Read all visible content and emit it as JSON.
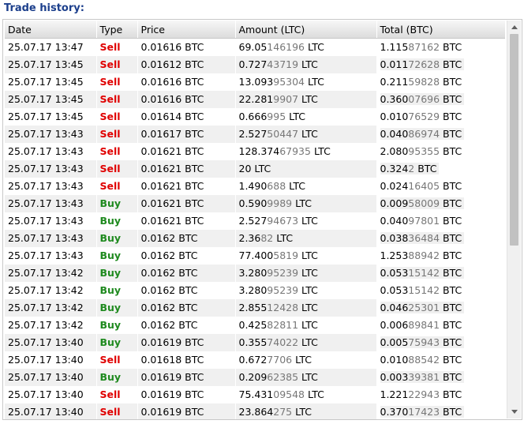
{
  "panel": {
    "title": "Trade history:"
  },
  "table": {
    "headers": [
      "Date",
      "Type",
      "Price",
      "Amount (LTC)",
      "Total (BTC)"
    ],
    "rows": [
      {
        "date": "25.07.17 13:47",
        "type": "Sell",
        "price": "0.01616 BTC",
        "amount": [
          "69.05",
          "146196",
          " LTC"
        ],
        "total": [
          "1.115",
          "87162",
          " BTC"
        ]
      },
      {
        "date": "25.07.17 13:45",
        "type": "Sell",
        "price": "0.01612 BTC",
        "amount": [
          "0.727",
          "43719",
          " LTC"
        ],
        "total": [
          "0.011",
          "72628",
          " BTC"
        ]
      },
      {
        "date": "25.07.17 13:45",
        "type": "Sell",
        "price": "0.01616 BTC",
        "amount": [
          "13.093",
          "95304",
          " LTC"
        ],
        "total": [
          "0.211",
          "59828",
          " BTC"
        ]
      },
      {
        "date": "25.07.17 13:45",
        "type": "Sell",
        "price": "0.01616 BTC",
        "amount": [
          "22.281",
          "9907",
          " LTC"
        ],
        "total": [
          "0.360",
          "07696",
          " BTC"
        ]
      },
      {
        "date": "25.07.17 13:45",
        "type": "Sell",
        "price": "0.01614 BTC",
        "amount": [
          "0.666",
          "995",
          " LTC"
        ],
        "total": [
          "0.010",
          "76529",
          " BTC"
        ]
      },
      {
        "date": "25.07.17 13:43",
        "type": "Sell",
        "price": "0.01617 BTC",
        "amount": [
          "2.527",
          "50447",
          " LTC"
        ],
        "total": [
          "0.040",
          "86974",
          " BTC"
        ]
      },
      {
        "date": "25.07.17 13:43",
        "type": "Sell",
        "price": "0.01621 BTC",
        "amount": [
          "128.374",
          "67935",
          " LTC"
        ],
        "total": [
          "2.080",
          "95355",
          " BTC"
        ]
      },
      {
        "date": "25.07.17 13:43",
        "type": "Sell",
        "price": "0.01621 BTC",
        "amount": [
          "20",
          "",
          "",
          " LTC"
        ],
        "total": [
          "0.324",
          "2",
          " BTC"
        ]
      },
      {
        "date": "25.07.17 13:43",
        "type": "Sell",
        "price": "0.01621 BTC",
        "amount": [
          "1.490",
          "688",
          " LTC"
        ],
        "total": [
          "0.024",
          "16405",
          " BTC"
        ]
      },
      {
        "date": "25.07.17 13:43",
        "type": "Buy",
        "price": "0.01621 BTC",
        "amount": [
          "0.590",
          "9989",
          " LTC"
        ],
        "total": [
          "0.009",
          "58009",
          " BTC"
        ]
      },
      {
        "date": "25.07.17 13:43",
        "type": "Buy",
        "price": "0.01621 BTC",
        "amount": [
          "2.527",
          "94673",
          " LTC"
        ],
        "total": [
          "0.040",
          "97801",
          " BTC"
        ]
      },
      {
        "date": "25.07.17 13:43",
        "type": "Buy",
        "price": "0.0162 BTC",
        "amount": [
          "2.36",
          "82",
          " LTC"
        ],
        "total": [
          "0.038",
          "36484",
          " BTC"
        ]
      },
      {
        "date": "25.07.17 13:43",
        "type": "Buy",
        "price": "0.0162 BTC",
        "amount": [
          "77.400",
          "5819",
          " LTC"
        ],
        "total": [
          "1.253",
          "88942",
          " BTC"
        ]
      },
      {
        "date": "25.07.17 13:42",
        "type": "Buy",
        "price": "0.0162 BTC",
        "amount": [
          "3.280",
          "95239",
          " LTC"
        ],
        "total": [
          "0.053",
          "15142",
          " BTC"
        ]
      },
      {
        "date": "25.07.17 13:42",
        "type": "Buy",
        "price": "0.0162 BTC",
        "amount": [
          "3.280",
          "95239",
          " LTC"
        ],
        "total": [
          "0.053",
          "15142",
          " BTC"
        ]
      },
      {
        "date": "25.07.17 13:42",
        "type": "Buy",
        "price": "0.0162 BTC",
        "amount": [
          "2.855",
          "12428",
          " LTC"
        ],
        "total": [
          "0.046",
          "25301",
          " BTC"
        ]
      },
      {
        "date": "25.07.17 13:42",
        "type": "Buy",
        "price": "0.0162 BTC",
        "amount": [
          "0.425",
          "82811",
          " LTC"
        ],
        "total": [
          "0.006",
          "89841",
          " BTC"
        ]
      },
      {
        "date": "25.07.17 13:40",
        "type": "Buy",
        "price": "0.01619 BTC",
        "amount": [
          "0.355",
          "74022",
          " LTC"
        ],
        "total": [
          "0.005",
          "75943",
          " BTC"
        ]
      },
      {
        "date": "25.07.17 13:40",
        "type": "Sell",
        "price": "0.01618 BTC",
        "amount": [
          "0.672",
          "7706",
          " LTC"
        ],
        "total": [
          "0.010",
          "88542",
          " BTC"
        ]
      },
      {
        "date": "25.07.17 13:40",
        "type": "Buy",
        "price": "0.01619 BTC",
        "amount": [
          "0.209",
          "62385",
          " LTC"
        ],
        "total": [
          "0.003",
          "39381",
          " BTC"
        ]
      },
      {
        "date": "25.07.17 13:40",
        "type": "Sell",
        "price": "0.01619 BTC",
        "amount": [
          "75.431",
          "09548",
          " LTC"
        ],
        "total": [
          "1.221",
          "22943",
          " BTC"
        ]
      },
      {
        "date": "25.07.17 13:40",
        "type": "Sell",
        "price": "0.01619 BTC",
        "amount": [
          "23.864",
          "275",
          " LTC"
        ],
        "total": [
          "0.370",
          "17423",
          " BTC"
        ]
      }
    ]
  },
  "colors": {
    "sell": "#e00000",
    "buy": "#1f8a1f",
    "title": "#1c3f8c",
    "dim_digits": "#777777"
  },
  "icons": {
    "scroll_up": "arrow-up-icon",
    "scroll_down": "arrow-down-icon"
  },
  "scroll": {
    "visible_fraction": 0.57
  }
}
